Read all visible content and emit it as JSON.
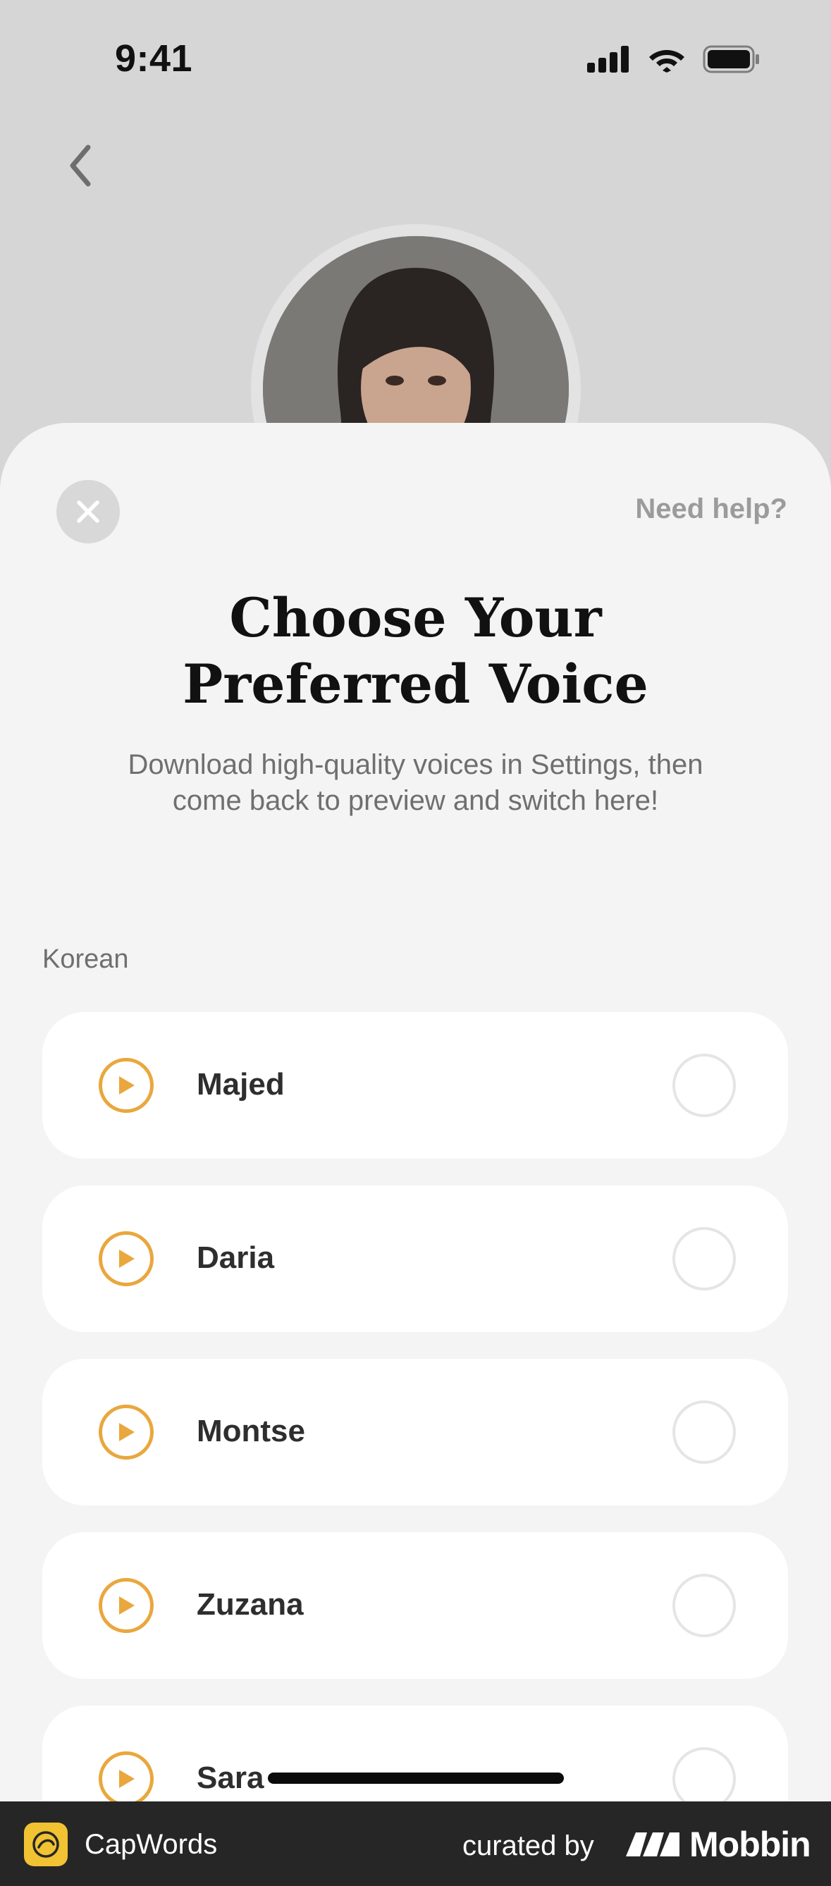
{
  "status_bar": {
    "time": "9:41",
    "icons": [
      "cellular-signal-icon",
      "wifi-icon",
      "battery-icon"
    ]
  },
  "nav": {
    "back_icon": "chevron-left-icon"
  },
  "profile": {
    "avatar_alt": "Voice assistant avatar"
  },
  "sheet": {
    "close_icon": "close-icon",
    "help_label": "Need help?",
    "title_line1": "Choose Your",
    "title_line2": "Preferred Voice",
    "subtitle": "Download high-quality voices in Settings, then come back to preview and switch here!",
    "section_label": "Korean",
    "voices": [
      {
        "name": "Majed",
        "selected": false
      },
      {
        "name": "Daria",
        "selected": false
      },
      {
        "name": "Montse",
        "selected": false
      },
      {
        "name": "Zuzana",
        "selected": false
      },
      {
        "name": "Sara",
        "selected": false
      }
    ],
    "accent_color": "#e9a73d"
  },
  "footer": {
    "app_name": "CapWords",
    "curated_by": "curated by",
    "brand": "Mobbin"
  }
}
